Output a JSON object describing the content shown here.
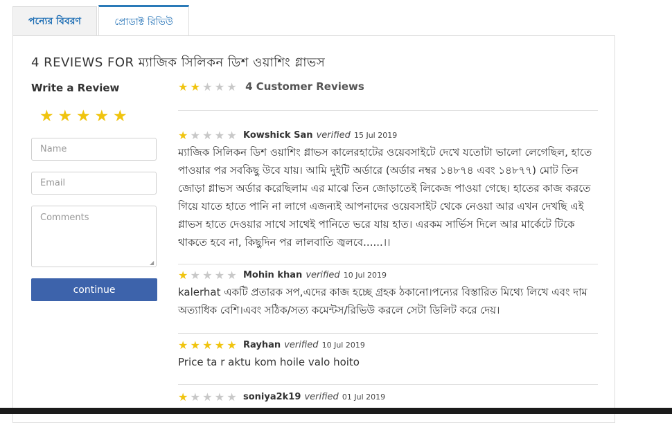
{
  "tabs": [
    {
      "label": "পন্যের বিবরণ",
      "active": false
    },
    {
      "label": "প্রোডাক্ট রিভিউ",
      "active": true
    }
  ],
  "panel_title": "4 REVIEWS FOR ম্যাজিক সিলিকন ডিশ ওয়াশিং গ্লাভস",
  "write_review": {
    "title": "Write a Review",
    "rating_stars": 5,
    "name_placeholder": "Name",
    "email_placeholder": "Email",
    "comments_placeholder": "Comments",
    "continue_label": "continue"
  },
  "summary": {
    "rating": 2,
    "label": "4 Customer Reviews"
  },
  "reviews": [
    {
      "rating": 1,
      "author": "Kowshick San",
      "verified": "verified",
      "date": "15 Jul 2019",
      "text": "ম্যাজিক সিলিকন ডিশ ওয়াশিং গ্লাভস কালেরহাটের ওয়েবসাইটে দেখে যতোটা ভালো লেগেছিল, হাতে পাওয়ার পর সবকিছু উবে যায়। আমি দুইটি অর্ডারে (অর্ডার নম্বর ১৪৮৭৪ এবং ১৪৮৭৭) মোট তিন জোড়া গ্লাভস অর্ডার করেছিলাম এর মাঝে তিন জোড়াতেই লিকেজ পাওয়া গেছে। হাতের কাজ করতে গিয়ে যাতে হাতে পানি না লাগে এজন্যই আপনাদের ওয়েবসাইট থেকে নেওয়া আর এখন দেখছি এই গ্লাভস হাতে দেওয়ার সাথে সাথেই পানিতে ভরে যায় হাত। এরকম সার্ভিস দিলে আর মার্কেটে টিকে থাকতে হবে না, কিছুদিন পর লালবাতি জ্বলবে......।।"
    },
    {
      "rating": 1,
      "author": "Mohin khan",
      "verified": "verified",
      "date": "10 Jul 2019",
      "text": "kalerhat একটি প্রতারক সপ,এদের কাজ হচ্ছে গ্রহক ঠকানো।পন্যের বিস্তারিত মিথ্যে লিখে এবং দাম অত্যাধিক বেশি।এবং সঠিক/সত্য কমেন্টস/রিভিউ করলে সেটা ডিলিট করে দেয়।"
    },
    {
      "rating": 5,
      "author": "Rayhan",
      "verified": "verified",
      "date": "10 Jul 2019",
      "text": "Price ta r aktu kom hoile valo hoito"
    },
    {
      "rating": 1,
      "author": "soniya2k19",
      "verified": "verified",
      "date": "01 Jul 2019",
      "text": ""
    }
  ],
  "colors": {
    "star_on": "#f0c40f",
    "star_off": "#c8c8c8",
    "button": "#3d63ab",
    "tab_text": "#1f6fb5"
  }
}
